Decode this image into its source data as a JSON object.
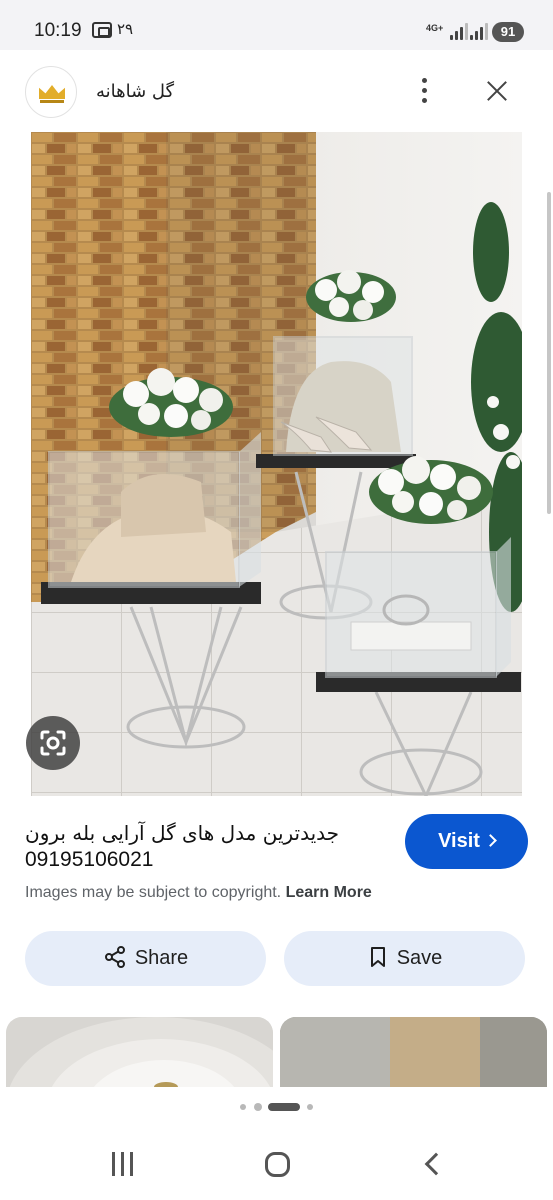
{
  "status_bar": {
    "time": "10:19",
    "notification_count": "۲۹",
    "network": "4G+",
    "battery": "91"
  },
  "header": {
    "site_name": "گل شاهانه",
    "logo": "crown-logo",
    "more_icon": "more-vert-icon",
    "close_icon": "close-icon"
  },
  "image": {
    "lens_icon": "google-lens-icon"
  },
  "details": {
    "title": "جدیدترین مدل های گل آرایی بله برون",
    "phone": "09195106021",
    "visit_label": "Visit",
    "copyright_text": "Images may be subject to copyright.",
    "learn_more": "Learn More"
  },
  "actions": {
    "share_label": "Share",
    "save_label": "Save"
  },
  "nav": {
    "recents_icon": "recents-icon",
    "home_icon": "home-icon",
    "back_icon": "back-icon"
  },
  "colors": {
    "accent": "#0b57d0",
    "button_bg": "#e6edf9"
  }
}
